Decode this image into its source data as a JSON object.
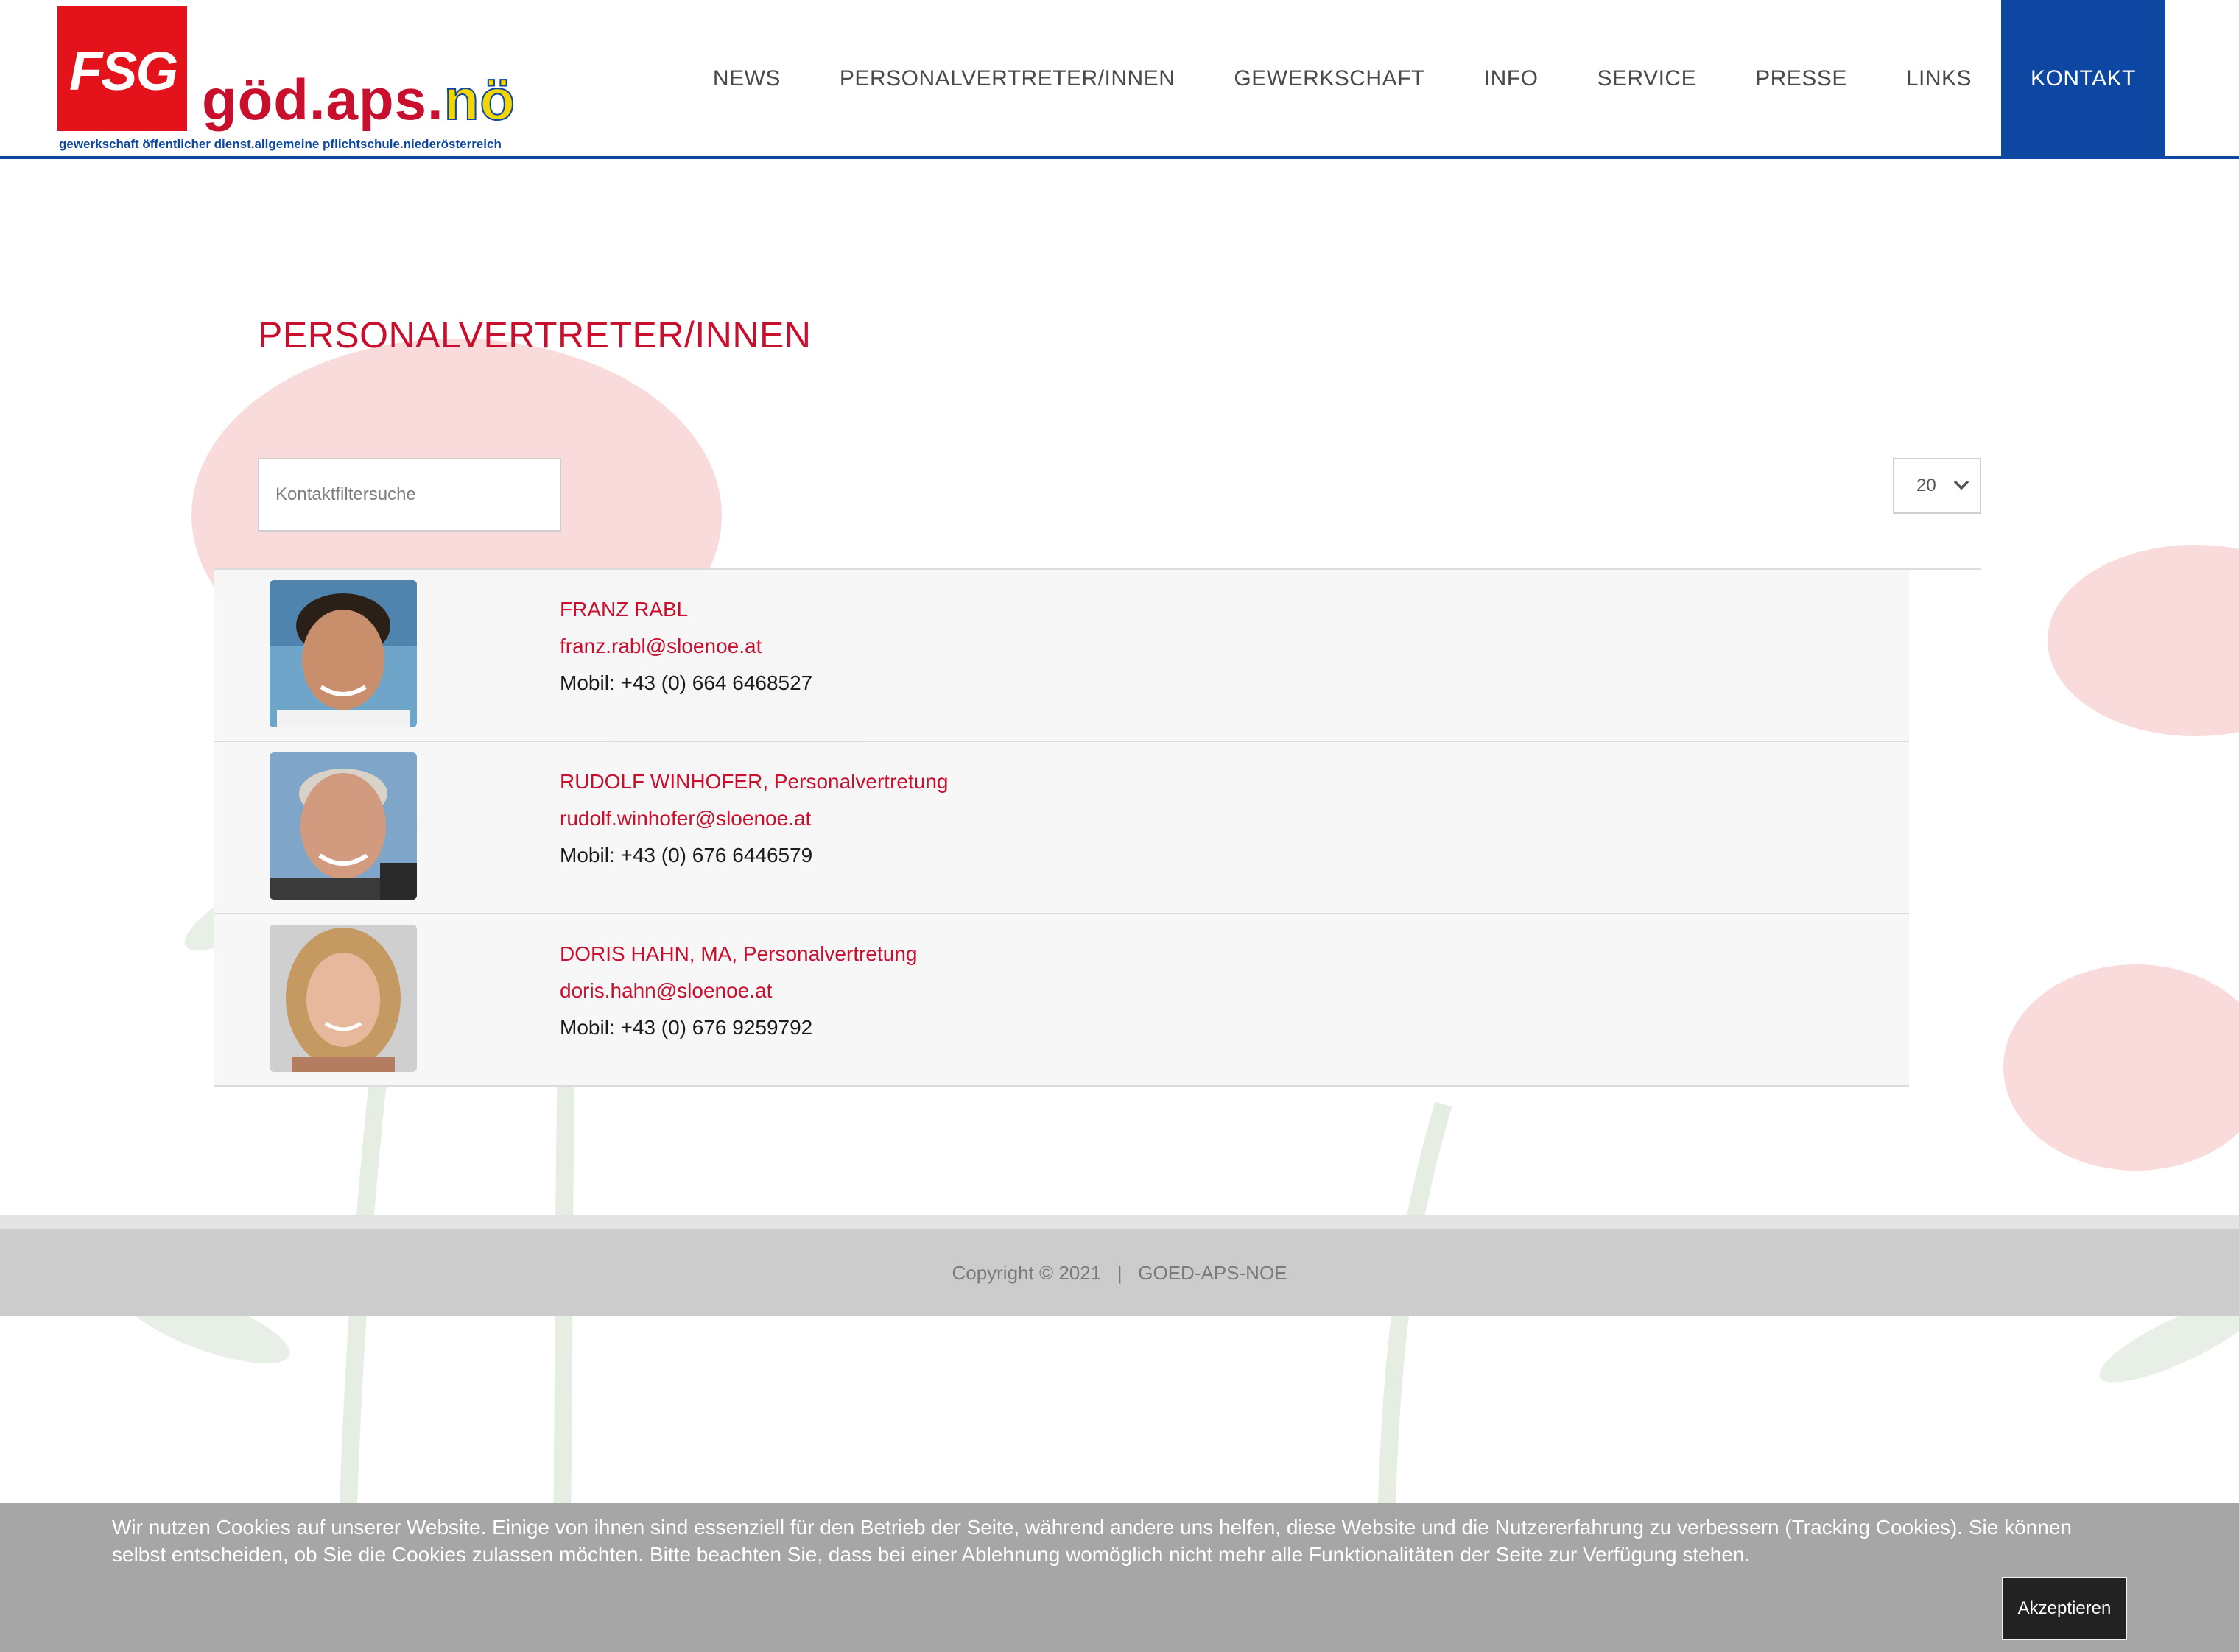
{
  "logo": {
    "badge": "FSG",
    "wordmark_main": "göd.aps.",
    "wordmark_accent": "nö",
    "subtitle": "gewerkschaft öffentlicher dienst.allgemeine pflichtschule.niederösterreich"
  },
  "nav": {
    "items": [
      {
        "label": "NEWS"
      },
      {
        "label": "PERSONALVERTRETER/INNEN"
      },
      {
        "label": "GEWERKSCHAFT"
      },
      {
        "label": "INFO"
      },
      {
        "label": "SERVICE"
      },
      {
        "label": "PRESSE"
      },
      {
        "label": "LINKS"
      },
      {
        "label": "KONTAKT",
        "active": true
      }
    ]
  },
  "main": {
    "title": "PERSONALVERTRETER/INNEN",
    "search": {
      "placeholder": "Kontaktfiltersuche",
      "value": ""
    },
    "per_page": {
      "selected": "20"
    },
    "contacts": [
      {
        "name": "FRANZ RABL",
        "email": "franz.rabl@sloenoe.at",
        "phone": "Mobil: +43 (0) 664 6468527"
      },
      {
        "name": "RUDOLF WINHOFER, Personalvertretung",
        "email": "rudolf.winhofer@sloenoe.at",
        "phone": "Mobil: +43 (0) 676 6446579"
      },
      {
        "name": "DORIS HAHN, MA, Personalvertretung",
        "email": "doris.hahn@sloenoe.at",
        "phone": "Mobil: +43 (0) 676 9259792"
      }
    ]
  },
  "footer": {
    "copyright": "Copyright © 2021   |   GOED-APS-NOE"
  },
  "cookie_banner": {
    "text": "Wir nutzen Cookies auf unserer Website. Einige von ihnen sind essenziell für den Betrieb der Seite, während andere uns helfen, diese Website und die Nutzererfahrung zu verbessern (Tracking Cookies). Sie können selbst entscheiden, ob Sie die Cookies zulassen möchten. Bitte beachten Sie, dass bei einer Ablehnung womöglich nicht mehr alle Funktionalitäten der Seite zur Verfügung stehen.",
    "accept_label": "Akzeptieren"
  },
  "colors": {
    "brand_red": "#c8102e",
    "nav_active_blue": "#0e47a1",
    "footer_gray": "#cccccc",
    "cookie_gray": "#a0a0a0"
  }
}
